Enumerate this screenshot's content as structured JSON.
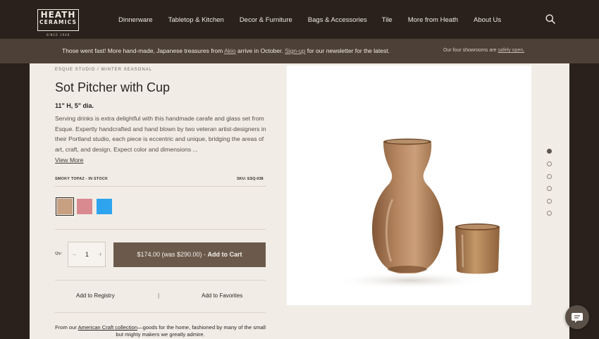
{
  "header": {
    "logo": {
      "line1": "HEATH",
      "line2": "CERAMICS",
      "line3": "SINCE 1948"
    },
    "nav": [
      "Dinnerware",
      "Tabletop & Kitchen",
      "Decor & Furniture",
      "Bags & Accessories",
      "Tile",
      "More from Heath",
      "About Us"
    ]
  },
  "banner": {
    "text_before": "Those went fast! More hand-made, Japanese treasures from ",
    "link1": "Akio",
    "text_middle": " arrive in October. ",
    "link2": "Sign-up",
    "text_after": " for our newsletter for the latest.",
    "side_text": "Our four showrooms are ",
    "side_link": "safely open."
  },
  "product": {
    "breadcrumb": "ESQUE STUDIO / WINTER SEASONAL",
    "title": "Sot Pitcher with Cup",
    "dimensions": "11\" H, 5\" dia.",
    "description": "Serving drinks is extra delightful with this handmade carafe and glass set from Esque. Expertly handcrafted and hand blown by two veteran artist-designers in their Portland studio, each piece is eccentric and unique, bridging the areas of art, craft, and design. Expect color and dimensions ...",
    "view_more": "View More",
    "variant": "SMOKY TOPAZ - IN STOCK",
    "sku": "SKU: ESQ-038",
    "swatches": [
      {
        "name": "smoky-topaz",
        "color": "#c79f81"
      },
      {
        "name": "pink",
        "color": "#d98a91"
      },
      {
        "name": "blue",
        "color": "#2ea4ee"
      }
    ],
    "qty_label": "Qty:",
    "qty_minus": "−",
    "qty_value": "1",
    "qty_plus": "+",
    "price_text": "$174.00 (was $290.00) - ",
    "cart_label": "Add to Cart",
    "registry": "Add to Registry",
    "separator": "|",
    "favorites": "Add to Favorites",
    "footer_before": "From our ",
    "footer_link": "American Craft collection",
    "footer_after": "—goods for the home, fashioned by many of the small but mighty makers we greatly admire."
  },
  "gallery": {
    "count": 6,
    "active": 0
  },
  "colors": {
    "accent": "#6b5a4c",
    "header": "#2a211c",
    "banner": "#4d4037",
    "panel": "#f1ede6"
  }
}
